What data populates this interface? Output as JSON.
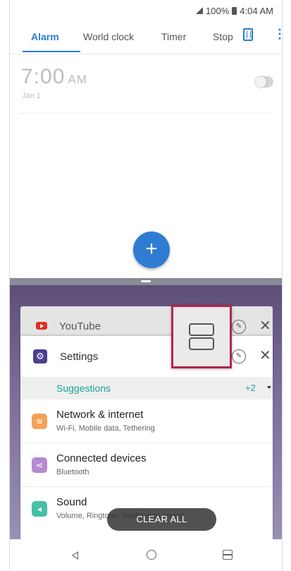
{
  "status_bar": {
    "battery": "100%",
    "time": "4:04 AM"
  },
  "clock_tabs": [
    {
      "label": "Alarm"
    },
    {
      "label": "World clock"
    },
    {
      "label": "Timer"
    },
    {
      "label": "Stop"
    }
  ],
  "alarm": {
    "time": "7:00",
    "ampm": "AM",
    "date": "Jan 1",
    "enabled": false
  },
  "fab_label": "+",
  "recents": {
    "youtube_label": "YouTube",
    "settings_label": "Settings",
    "suggestions_label": "Suggestions",
    "suggestions_count": "+2",
    "settings_items": [
      {
        "title": "Network & internet",
        "subtitle": "Wi-Fi, Mobile data, Tethering",
        "color": "#f4a25a",
        "icon": "wifi-icon"
      },
      {
        "title": "Connected devices",
        "subtitle": "Bluetooth",
        "color": "#b58ad0",
        "icon": "share-icon"
      },
      {
        "title": "Sound",
        "subtitle": "Volume, Ringtone, Notification sound",
        "color": "#46c0a8",
        "icon": "volume-icon"
      }
    ],
    "clear_all_label": "CLEAR ALL"
  },
  "colors": {
    "accent": "#2a7bd4",
    "highlight_border": "#b3264e"
  }
}
